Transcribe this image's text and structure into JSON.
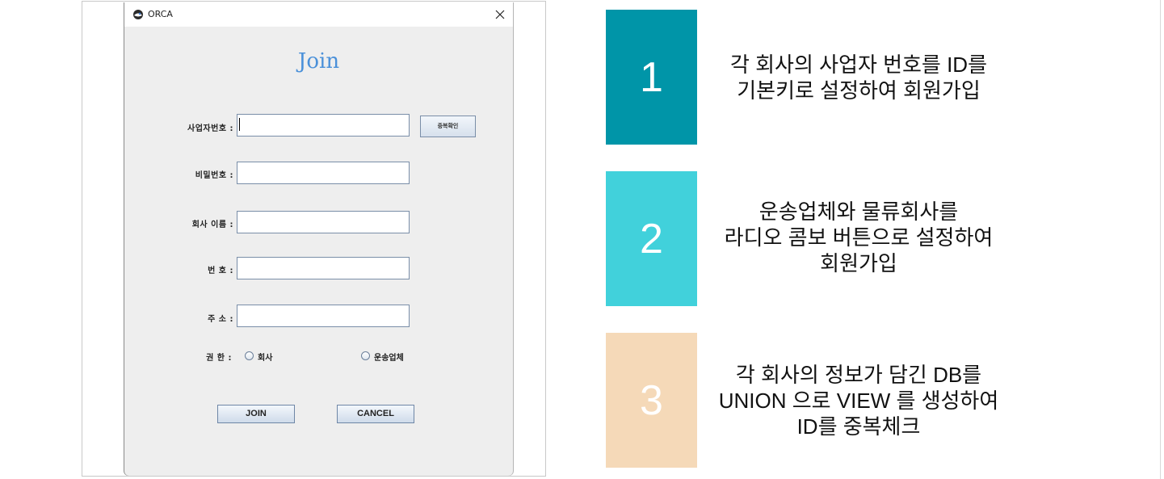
{
  "window": {
    "title": "ORCA",
    "heading": "Join"
  },
  "form": {
    "biz_no_label": "사업자번호 :",
    "biz_no_value": "",
    "dup_check_label": "중복확인",
    "password_label": "비밀번호 :",
    "password_value": "",
    "company_name_label": "회사 이름 :",
    "company_name_value": "",
    "phone_label": "번 호 :",
    "phone_value": "",
    "address_label": "주 소 :",
    "address_value": "",
    "role_label": "권 한 :",
    "role_options": [
      "회사",
      "운송업체"
    ],
    "join_button": "JOIN",
    "cancel_button": "CANCEL"
  },
  "steps": [
    {
      "number": "1",
      "color": "#0095a8",
      "lines": [
        "각 회사의 사업자 번호를 ID를",
        "기본키로 설정하여 회원가입"
      ]
    },
    {
      "number": "2",
      "color": "#41d1db",
      "lines": [
        "운송업체와 물류회사를",
        "라디오 콤보 버튼으로 설정하여",
        "회원가입"
      ]
    },
    {
      "number": "3",
      "color": "#f5d9b8",
      "lines": [
        "각 회사의 정보가 담긴 DB를",
        "UNION 으로 VIEW 를 생성하여",
        "ID를 중복체크"
      ]
    }
  ]
}
